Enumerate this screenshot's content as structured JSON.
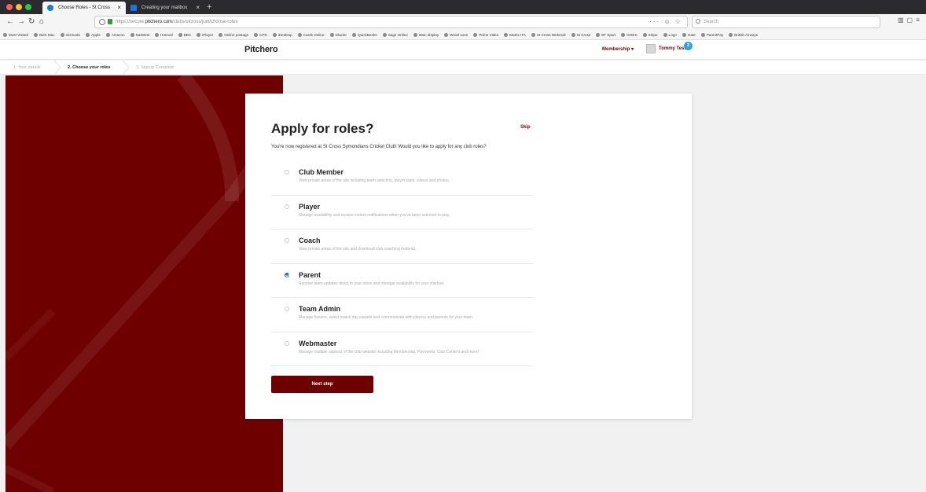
{
  "browser": {
    "tabs": [
      {
        "label": "Choose Roles - St Cross Symo...",
        "close": "×"
      },
      {
        "label": "Creating your mailbox",
        "close": "×"
      }
    ],
    "new_tab": "+",
    "url_prefix": "https://secure.",
    "url_host": "pitchero.com",
    "url_path": "/clubs/stcross/join/choose-roles",
    "url_icons": "··· ☺ ☆",
    "search_placeholder": "Search",
    "bookmarks": [
      "Most Visited",
      "BidX Mac",
      "Gizmodo",
      "Apple",
      "Amazon",
      "NatWest",
      "Hotmail",
      "BBC",
      "iPlayer",
      "Online postage",
      "CPD",
      "iDesktop",
      "Cards Online",
      "Glacier",
      "QuickBooks",
      "Sage Online",
      "iMac display",
      "Wood oven",
      "Prime Video",
      "Matrix ITA",
      "St Cross Webmail",
      "St Cross",
      "BT Sport",
      "GOES",
      "Stripe",
      "Logo",
      "Gate",
      "ParentPay",
      "British Airways"
    ]
  },
  "header": {
    "logo": "Pitchero",
    "membership": "Membership ▾",
    "user_name": "Tommy Test",
    "badge": "2"
  },
  "steps": [
    "1. Your details",
    "2. Choose your roles",
    "3. Signup Complete"
  ],
  "card": {
    "title": "Apply for roles?",
    "skip": "Skip",
    "intro": "You're now registered at St Cross Symondians Cricket Club! Would you like to apply for any club roles?",
    "roles": [
      {
        "name": "Club Member",
        "desc": "View private areas of the site including team selection, player stats, videos and photos.",
        "checked": false
      },
      {
        "name": "Player",
        "desc": "Manage availability and receive instant notifications when you've been selected to play.",
        "checked": false
      },
      {
        "name": "Coach",
        "desc": "View private areas of the site and download club coaching material.",
        "checked": false
      },
      {
        "name": "Parent",
        "desc": "Receive team updates direct to your inbox and manage availability for your children.",
        "checked": true
      },
      {
        "name": "Team Admin",
        "desc": "Manage fixtures, select match day squads and communicate with players and parents for your team.",
        "checked": false
      },
      {
        "name": "Webmaster",
        "desc": "Manage multiple aspects of the club website including Membership, Payments, Club Content and more!",
        "checked": false
      }
    ],
    "next_label": "Next step"
  },
  "colors": {
    "brand": "#6e0000",
    "checkbox": "#1d6fd8",
    "badge": "#2aa3e8"
  }
}
